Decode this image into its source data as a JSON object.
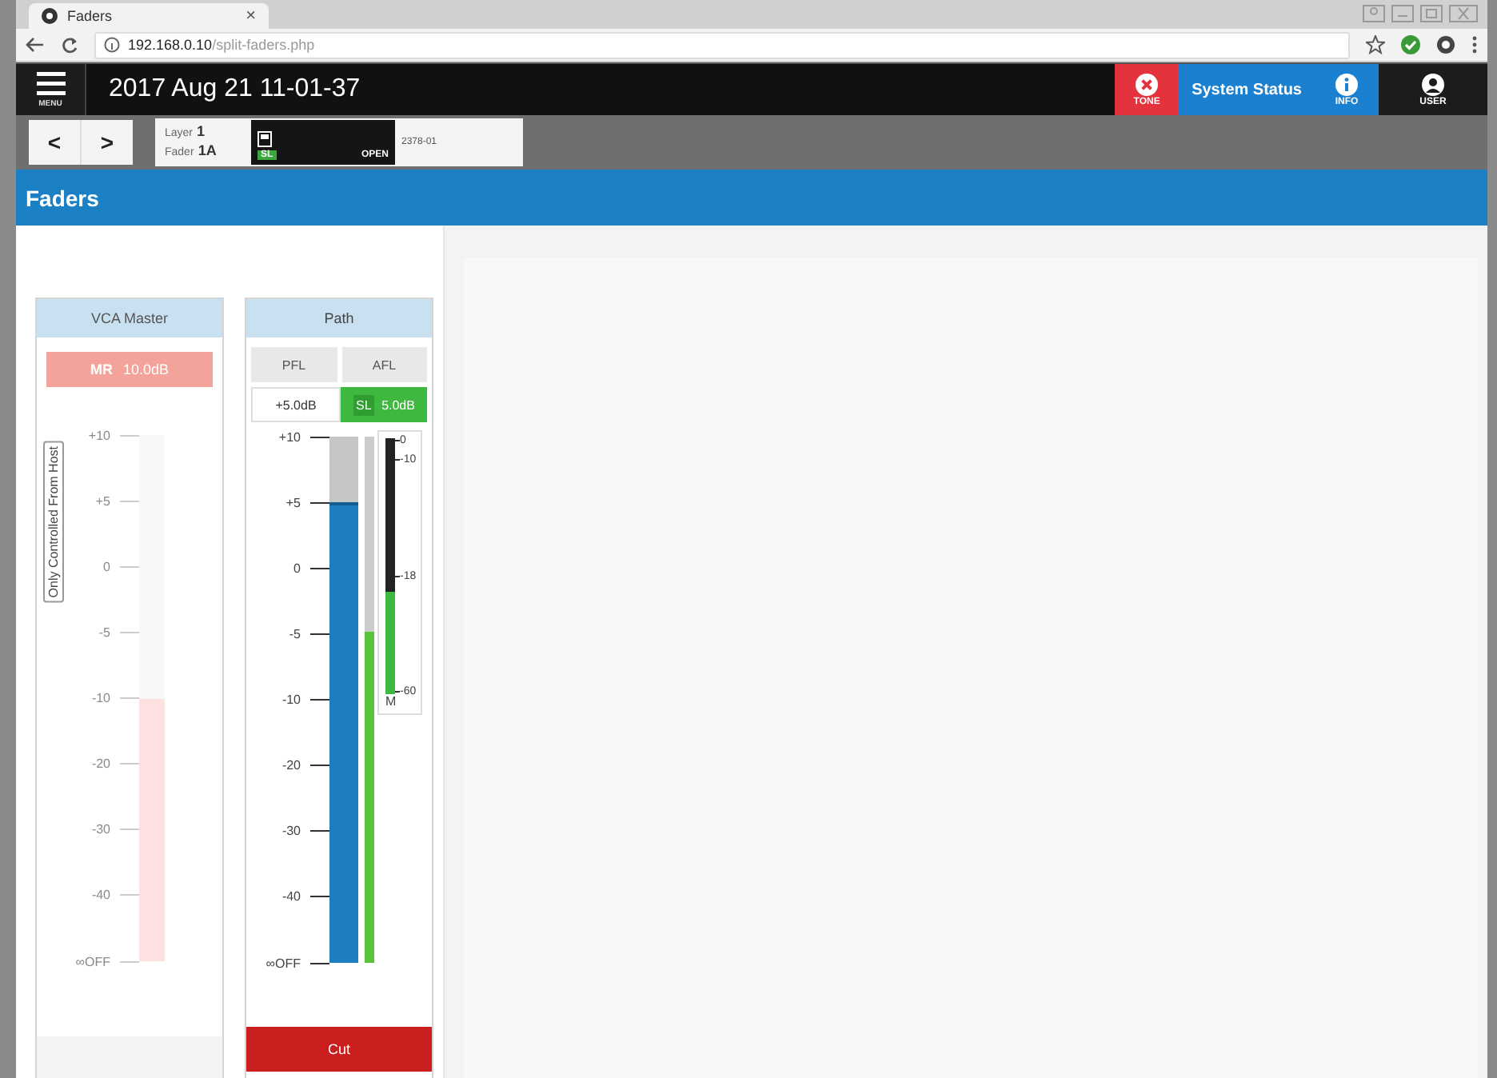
{
  "browser": {
    "tab": {
      "title": "Faders",
      "close": "×"
    },
    "address": {
      "host": "192.168.0.10",
      "path": "/split-faders.php"
    }
  },
  "header": {
    "menu_label": "MENU",
    "datetime": "2017 Aug 21 11-01-37",
    "buttons": [
      {
        "kind": "icon",
        "label": "TONE",
        "color": "#e5333d"
      },
      {
        "kind": "text",
        "label": "System Status",
        "color": "#1b80cf"
      },
      {
        "kind": "icon",
        "label": "INFO",
        "color": "#1b80cf"
      },
      {
        "kind": "icon",
        "label": "USER",
        "color": "#1c1c1c"
      }
    ]
  },
  "toolbar": {
    "prev": "<",
    "next": ">",
    "layer": {
      "label": "Layer",
      "value": "1"
    },
    "fader": {
      "label": "Fader",
      "value": "1A"
    },
    "status": {
      "badge": "SL",
      "state": "OPEN"
    },
    "code": "2378-01"
  },
  "page_title": "Faders",
  "strips": [
    {
      "kind": "vca",
      "title": "VCA Master",
      "disabled": true,
      "mute": {
        "label": "MR",
        "value": "10.0dB"
      },
      "side_label": "Only Controlled From Host",
      "scale": [
        "+10",
        "+5",
        "0",
        "-5",
        "-10",
        "-20",
        "-30",
        "-40",
        "∞OFF"
      ],
      "fader": {
        "level": 0.5
      }
    },
    {
      "kind": "path",
      "title": "Path",
      "disabled": false,
      "buttons": [
        {
          "label": "PFL",
          "selected": false
        },
        {
          "label": "AFL",
          "selected": false
        }
      ],
      "gain": "+5.0dB",
      "sl": {
        "label": "SL",
        "value": "5.0dB"
      },
      "scale": [
        "+10",
        "+5",
        "0",
        "-5",
        "-10",
        "-20",
        "-30",
        "-40",
        "∞OFF"
      ],
      "fader": {
        "level": 0.875
      },
      "meter": {
        "level": 0.63
      },
      "loudness": {
        "level": 0.4,
        "scale": [
          "0",
          "-10",
          "-18",
          "-60"
        ],
        "label": "M"
      },
      "cut": {
        "label": "Cut",
        "on": true
      }
    }
  ]
}
